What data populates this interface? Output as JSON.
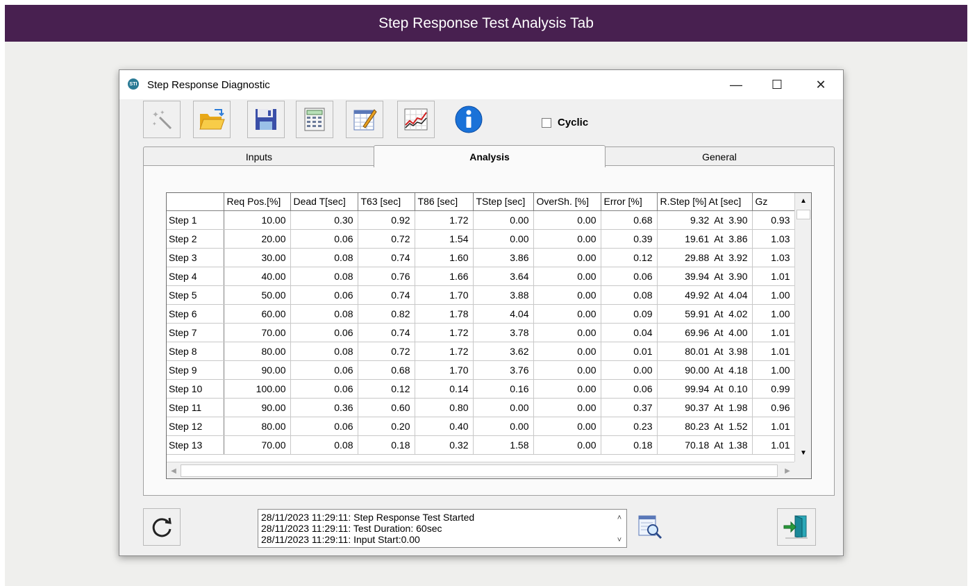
{
  "banner": {
    "title": "Step Response Test Analysis Tab"
  },
  "window": {
    "title": "Step Response Diagnostic",
    "controls": {
      "minimize": "—",
      "maximize": "☐",
      "close": "✕"
    }
  },
  "toolbar": {
    "buttons": [
      "magic-wand",
      "open-folder",
      "save",
      "calculator",
      "edit-sheet",
      "chart",
      "info"
    ],
    "cyclic_label": "Cyclic",
    "cyclic_checked": false
  },
  "tabs": [
    {
      "label": "Inputs",
      "active": false
    },
    {
      "label": "Analysis",
      "active": true
    },
    {
      "label": "General",
      "active": false
    }
  ],
  "grid": {
    "headers": [
      "",
      "Req Pos.[%]",
      "Dead T[sec]",
      "T63 [sec]",
      "T86 [sec]",
      "TStep [sec]",
      "OverSh. [%]",
      "Error [%]",
      "R.Step [%] At [sec]",
      "Gz"
    ],
    "rows": [
      [
        "Step 1",
        "10.00",
        "0.30",
        "0.92",
        "1.72",
        "0.00",
        "0.00",
        "0.68",
        "9.32  At  3.90",
        "0.93"
      ],
      [
        "Step 2",
        "20.00",
        "0.06",
        "0.72",
        "1.54",
        "0.00",
        "0.00",
        "0.39",
        "19.61  At  3.86",
        "1.03"
      ],
      [
        "Step 3",
        "30.00",
        "0.08",
        "0.74",
        "1.60",
        "3.86",
        "0.00",
        "0.12",
        "29.88  At  3.92",
        "1.03"
      ],
      [
        "Step 4",
        "40.00",
        "0.08",
        "0.76",
        "1.66",
        "3.64",
        "0.00",
        "0.06",
        "39.94  At  3.90",
        "1.01"
      ],
      [
        "Step 5",
        "50.00",
        "0.06",
        "0.74",
        "1.70",
        "3.88",
        "0.00",
        "0.08",
        "49.92  At  4.04",
        "1.00"
      ],
      [
        "Step 6",
        "60.00",
        "0.08",
        "0.82",
        "1.78",
        "4.04",
        "0.00",
        "0.09",
        "59.91  At  4.02",
        "1.00"
      ],
      [
        "Step 7",
        "70.00",
        "0.06",
        "0.74",
        "1.72",
        "3.78",
        "0.00",
        "0.04",
        "69.96  At  4.00",
        "1.01"
      ],
      [
        "Step 8",
        "80.00",
        "0.08",
        "0.72",
        "1.72",
        "3.62",
        "0.00",
        "0.01",
        "80.01  At  3.98",
        "1.01"
      ],
      [
        "Step 9",
        "90.00",
        "0.06",
        "0.68",
        "1.70",
        "3.76",
        "0.00",
        "0.00",
        "90.00  At  4.18",
        "1.00"
      ],
      [
        "Step 10",
        "100.00",
        "0.06",
        "0.12",
        "0.14",
        "0.16",
        "0.00",
        "0.06",
        "99.94  At  0.10",
        "0.99"
      ],
      [
        "Step 11",
        "90.00",
        "0.36",
        "0.60",
        "0.80",
        "0.00",
        "0.00",
        "0.37",
        "90.37  At  1.98",
        "0.96"
      ],
      [
        "Step 12",
        "80.00",
        "0.06",
        "0.20",
        "0.40",
        "0.00",
        "0.00",
        "0.23",
        "80.23  At  1.52",
        "1.01"
      ],
      [
        "Step 13",
        "70.00",
        "0.08",
        "0.18",
        "0.32",
        "1.58",
        "0.00",
        "0.18",
        "70.18  At  1.38",
        "1.01"
      ]
    ]
  },
  "log": {
    "lines": [
      "28/11/2023 11:29:11: Step Response Test Started",
      "28/11/2023 11:29:11: Test Duration: 60sec",
      "28/11/2023 11:29:11: Input Start:0.00"
    ]
  }
}
